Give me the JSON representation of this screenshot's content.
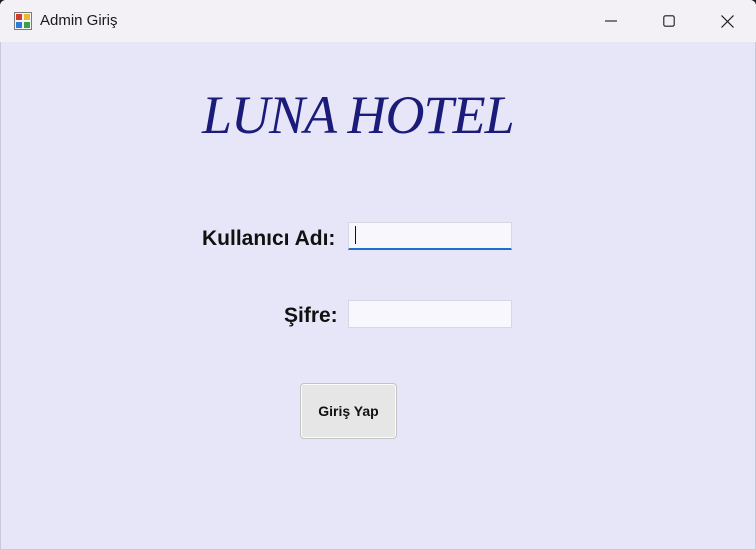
{
  "window": {
    "title": "Admin Giriş",
    "app_icon": "winforms-app-icon",
    "controls": {
      "minimize_icon": "minimize-icon",
      "maximize_icon": "maximize-icon",
      "close_icon": "close-icon"
    }
  },
  "form": {
    "heading": "LUNA HOTEL",
    "username_label": "Kullanıcı Adı:",
    "username_value": "",
    "password_label": "Şifre:",
    "password_value": "",
    "submit_label": "Giriş Yap"
  },
  "colors": {
    "background": "#e6e6f8",
    "titlebar": "#f3f0f6",
    "heading": "#1b1b7a",
    "focus_accent": "#1f6fd1"
  }
}
